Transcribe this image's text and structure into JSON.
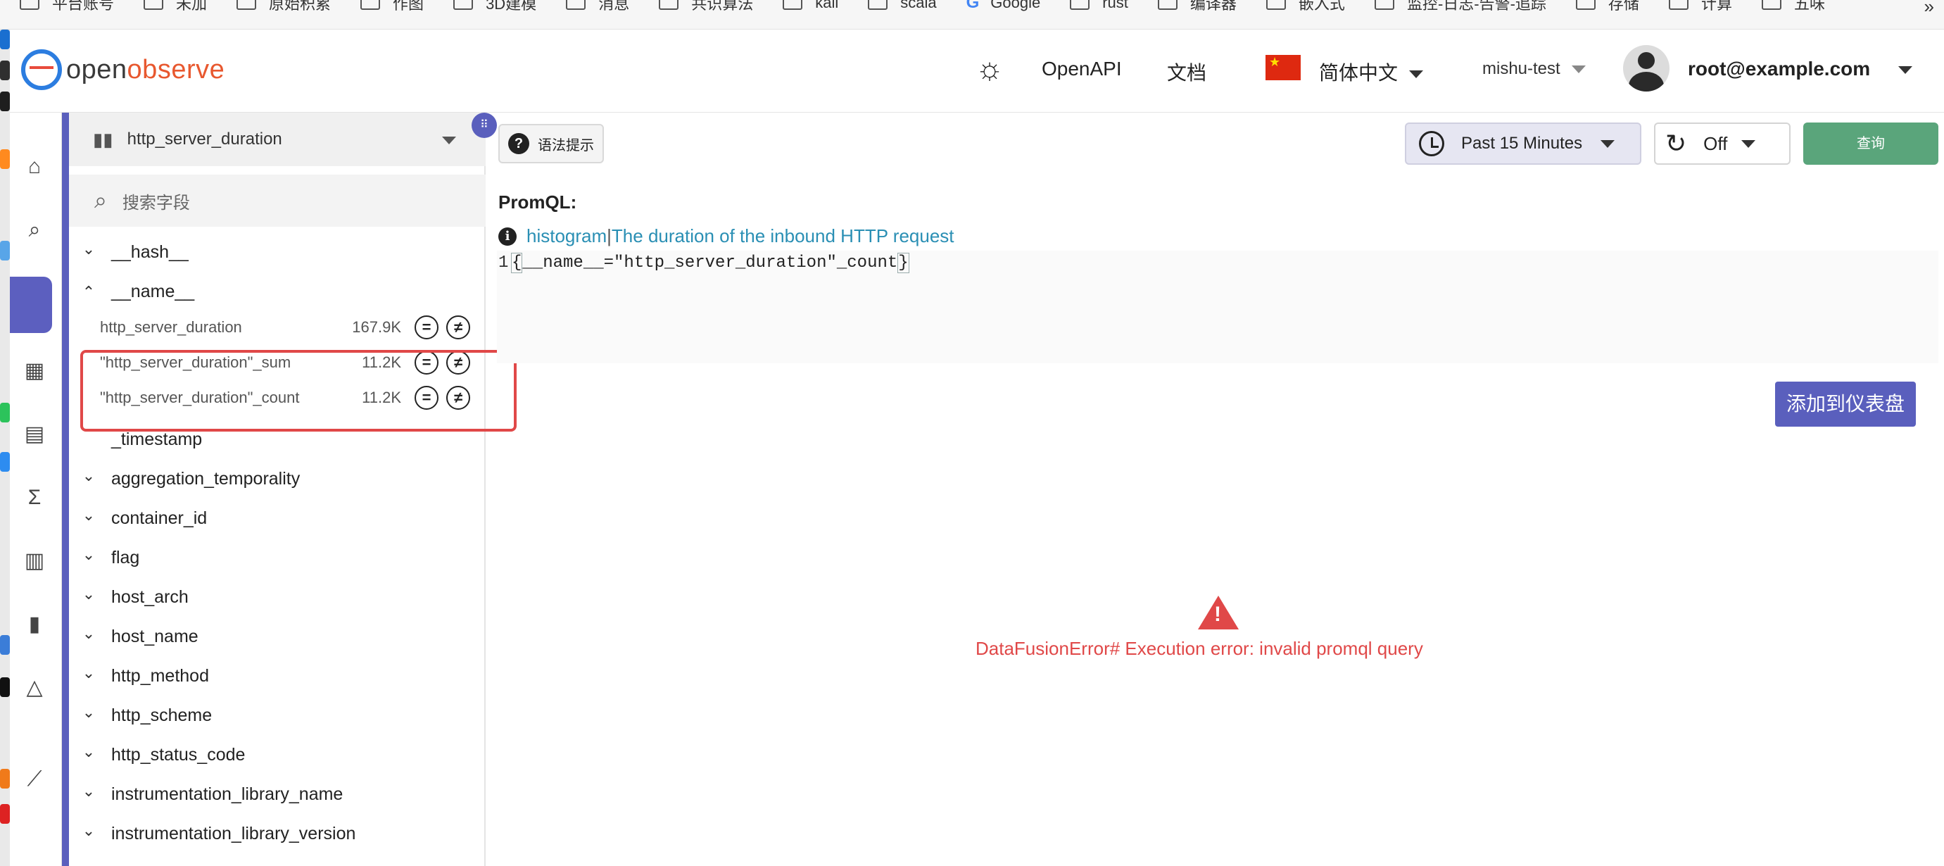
{
  "bookmarks": [
    "平台账号",
    "未加",
    "原始积累",
    "作图",
    "3D建模",
    "消息",
    "共识算法",
    "kali",
    "scala",
    "Google",
    "rust",
    "编译器",
    "嵌入式",
    "监控-日志-告警-追踪",
    "存储",
    "计算",
    "五味"
  ],
  "bookmarks_more": "»",
  "header": {
    "logo_part1": "open",
    "logo_part2": "observe",
    "openapi_label": "OpenAPI",
    "docs_label": "文档",
    "language_label": "简体中文",
    "org_label": "mishu-test",
    "user_email": "root@example.com"
  },
  "fields_panel": {
    "metric_name": "http_server_duration",
    "search_placeholder": "搜索字段",
    "fields": [
      {
        "name": "__hash__",
        "expanded": false
      },
      {
        "name": "__name__",
        "expanded": true
      },
      {
        "name": "_timestamp",
        "expanded": null
      },
      {
        "name": "aggregation_temporality",
        "expanded": false
      },
      {
        "name": "container_id",
        "expanded": false
      },
      {
        "name": "flag",
        "expanded": false
      },
      {
        "name": "host_arch",
        "expanded": false
      },
      {
        "name": "host_name",
        "expanded": false
      },
      {
        "name": "http_method",
        "expanded": false
      },
      {
        "name": "http_scheme",
        "expanded": false
      },
      {
        "name": "http_status_code",
        "expanded": false
      },
      {
        "name": "instrumentation_library_name",
        "expanded": false
      },
      {
        "name": "instrumentation_library_version",
        "expanded": false
      }
    ],
    "name_values": [
      {
        "value": "http_server_duration",
        "count": "167.9K"
      },
      {
        "value": "\"http_server_duration\"_sum",
        "count": "11.2K"
      },
      {
        "value": "\"http_server_duration\"_count",
        "count": "11.2K"
      }
    ],
    "eq_symbol": "=",
    "neq_symbol": "≠"
  },
  "toolbar": {
    "syntax_help_label": "语法提示",
    "time_range": "Past 15 Minutes",
    "refresh_label": "Off",
    "query_label": "查询"
  },
  "editor": {
    "label": "PromQL:",
    "metric_type": "histogram",
    "separator": " | ",
    "metric_description": "The duration of the inbound HTTP request",
    "line_number": "1",
    "code_open": "{",
    "code_body": "__name__=\"http_server_duration\"_count",
    "code_close": "}"
  },
  "add_to_dashboard_label": "添加到仪表盘",
  "error_message": "DataFusionError# Execution error: invalid promql query"
}
